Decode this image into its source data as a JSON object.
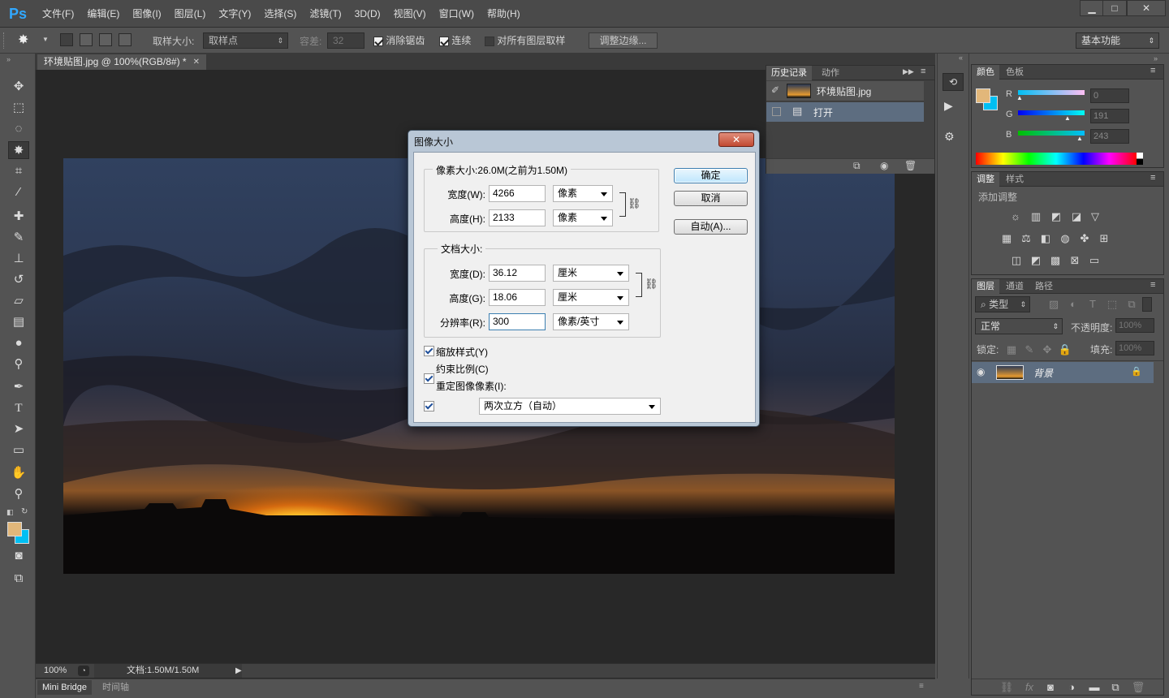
{
  "menubar": {
    "logo": "Ps",
    "items": [
      "文件(F)",
      "编辑(E)",
      "图像(I)",
      "图层(L)",
      "文字(Y)",
      "选择(S)",
      "滤镜(T)",
      "3D(D)",
      "视图(V)",
      "窗口(W)",
      "帮助(H)"
    ]
  },
  "optionsbar": {
    "sample_size_label": "取样大小:",
    "sample_size_value": "取样点",
    "tolerance_label": "容差:",
    "tolerance_value": "32",
    "antialias": "消除锯齿",
    "contiguous": "连续",
    "sample_all": "对所有图层取样",
    "refine_edge": "调整边缘...",
    "workspace": "基本功能"
  },
  "document": {
    "tab_title": "环境贴图.jpg @ 100%(RGB/8#) *",
    "zoom": "100%",
    "doc_info": "文档:1.50M/1.50M"
  },
  "bottombar": {
    "tabs": [
      "Mini Bridge",
      "时间轴"
    ]
  },
  "history_panel": {
    "tabs": [
      "历史记录",
      "动作"
    ],
    "snapshot": "环境贴图.jpg",
    "items": [
      "打开"
    ]
  },
  "color_panel": {
    "tabs": [
      "颜色",
      "色板"
    ],
    "r_label": "R",
    "g_label": "G",
    "b_label": "B",
    "r": "0",
    "g": "191",
    "b": "243",
    "fg_color": "#e2b77a",
    "bg_color": "#00bff3"
  },
  "adjust_panel": {
    "tabs": [
      "调整",
      "样式"
    ],
    "title": "添加调整"
  },
  "layers_panel": {
    "tabs": [
      "图层",
      "通道",
      "路径"
    ],
    "filter_kind": "类型",
    "blend_mode": "正常",
    "opacity_label": "不透明度:",
    "opacity_value": "100%",
    "lock_label": "锁定:",
    "fill_label": "填充:",
    "fill_value": "100%",
    "layers": [
      {
        "name": "背景"
      }
    ]
  },
  "dialog": {
    "title": "图像大小",
    "pixel_group_label": "像素大小:26.0M(之前为1.50M)",
    "px_width_label": "宽度(W):",
    "px_width_value": "4266",
    "px_width_unit": "像素",
    "px_height_label": "高度(H):",
    "px_height_value": "2133",
    "px_height_unit": "像素",
    "doc_group_label": "文档大小:",
    "doc_width_label": "宽度(D):",
    "doc_width_value": "36.12",
    "doc_width_unit": "厘米",
    "doc_height_label": "高度(G):",
    "doc_height_value": "18.06",
    "doc_height_unit": "厘米",
    "resolution_label": "分辨率(R):",
    "resolution_value": "300",
    "resolution_unit": "像素/英寸",
    "scale_styles": "缩放样式(Y)",
    "constrain": "约束比例(C)",
    "resample": "重定图像像素(I):",
    "resample_method": "两次立方（自动）",
    "ok": "确定",
    "cancel": "取消",
    "auto": "自动(A)..."
  }
}
